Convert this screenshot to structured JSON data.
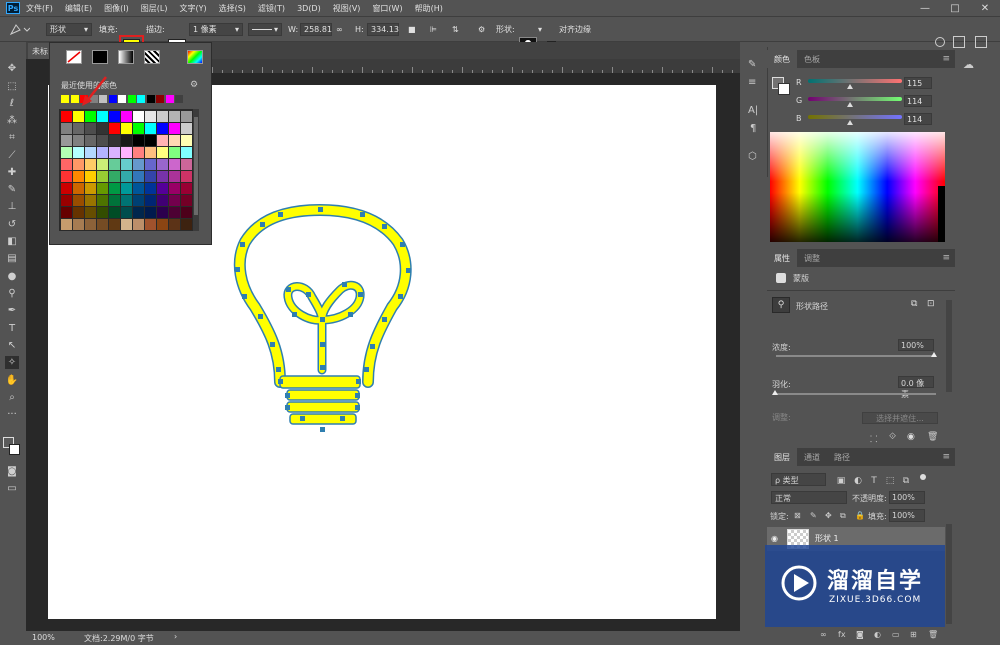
{
  "app": {
    "logo": "Ps"
  },
  "menu": [
    "文件(F)",
    "编辑(E)",
    "图像(I)",
    "图层(L)",
    "文字(Y)",
    "选择(S)",
    "滤镜(T)",
    "3D(D)",
    "视图(V)",
    "窗口(W)",
    "帮助(H)"
  ],
  "window_controls": {
    "minimize": "—",
    "maximize": "□",
    "close": "✕"
  },
  "options": {
    "mode": "形状",
    "fill_label": "填充:",
    "fill_color": "#ffff00",
    "stroke_label": "描边:",
    "stroke_width": "1 像素",
    "w_label": "W:",
    "w_value": "258.81",
    "h_label": "H:",
    "h_value": "334.13",
    "shape_label": "形状:",
    "align_edges": "对齐边缘"
  },
  "document": {
    "tab": "未标",
    "zoom": "100%",
    "doc_info": "文档:2.29M/0 字节"
  },
  "swatch_popup": {
    "recent_label": "最近使用的颜色",
    "recent": [
      "#ffff00",
      "#ffff00",
      "#ff0000",
      "#808080",
      "#c0c0c0",
      "#0000ff",
      "#ffffff",
      "#00ff00",
      "#00ffff",
      "#000000",
      "#8b0000",
      "#ff00ff",
      "#404040"
    ],
    "grid": [
      [
        "#ff0000",
        "#ffff00",
        "#00ff00",
        "#00ffff",
        "#0000ff",
        "#ff00ff",
        "#ffffff",
        "#e6e6e6",
        "#cccccc",
        "#b3b3b3",
        "#999999"
      ],
      [
        "#808080",
        "#666666",
        "#4d4d4d",
        "#333333",
        "#ff0000",
        "#ffff00",
        "#00ff00",
        "#00ffff",
        "#0000ff",
        "#ff00ff",
        "#cccccc"
      ],
      [
        "#999999",
        "#808080",
        "#666666",
        "#4d4d4d",
        "#333333",
        "#1a1a1a",
        "#000000",
        "#000000",
        "#ffb3b3",
        "#ffd9b3",
        "#ffffb3"
      ],
      [
        "#b3ffb3",
        "#b3ffff",
        "#b3d9ff",
        "#b3b3ff",
        "#d9b3ff",
        "#ffb3ff",
        "#ff8080",
        "#ffbf80",
        "#ffff80",
        "#80ff80",
        "#80ffff"
      ],
      [
        "#ff6666",
        "#ff9966",
        "#ffcc66",
        "#ccee77",
        "#66cc99",
        "#66cccc",
        "#6699cc",
        "#6666cc",
        "#9966cc",
        "#cc66cc",
        "#cc6699"
      ],
      [
        "#ff3333",
        "#ff8800",
        "#ffcc00",
        "#99cc33",
        "#33aa66",
        "#33aaaa",
        "#3377bb",
        "#3344aa",
        "#7733aa",
        "#aa3399",
        "#cc3366"
      ],
      [
        "#cc0000",
        "#cc6600",
        "#cc9900",
        "#669900",
        "#009944",
        "#009999",
        "#005599",
        "#003399",
        "#550099",
        "#990066",
        "#990033"
      ],
      [
        "#990000",
        "#994d00",
        "#997300",
        "#4d7300",
        "#00733a",
        "#007373",
        "#004073",
        "#002673",
        "#400073",
        "#73004d",
        "#730026"
      ],
      [
        "#660000",
        "#663300",
        "#664d00",
        "#334d00",
        "#004d26",
        "#004d4d",
        "#00264d",
        "#001a4d",
        "#2b004d",
        "#4d0033",
        "#4d001a"
      ],
      [
        "#c69c6d",
        "#a67c52",
        "#8c6239",
        "#754c24",
        "#603913",
        "#d2b48c",
        "#bc8f6a",
        "#a0522d",
        "#8b4513",
        "#5c3317",
        "#3d2210"
      ]
    ]
  },
  "color_panel": {
    "tabs": [
      "颜色",
      "色板"
    ],
    "channels": [
      {
        "label": "R",
        "value": "115"
      },
      {
        "label": "G",
        "value": "114"
      },
      {
        "label": "B",
        "value": "114"
      }
    ]
  },
  "properties_panel": {
    "tabs": [
      "属性",
      "调整"
    ],
    "mask_label": "蒙版",
    "shape_path_label": "形状路径",
    "density_label": "浓度:",
    "density_value": "100%",
    "feather_label": "羽化:",
    "feather_value": "0.0 像素",
    "refine_label": "调整:",
    "select_invert": "选择并遮住..."
  },
  "layers_panel": {
    "tabs": [
      "图层",
      "通道",
      "路径"
    ],
    "filter_kind": "ρ 类型",
    "blend_mode": "正常",
    "opacity_label": "不透明度:",
    "opacity_value": "100%",
    "lock_label": "锁定:",
    "fill_label": "填充:",
    "fill_value": "100%",
    "layer_name": "形状 1"
  },
  "watermark": {
    "brand": "溜溜自学",
    "url": "ZIXUE.3D66.COM"
  }
}
